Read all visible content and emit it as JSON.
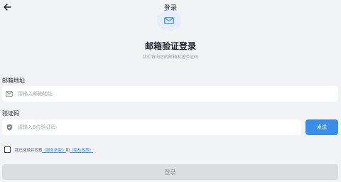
{
  "header": {
    "title": "登录",
    "back_icon": "arrow-left-icon"
  },
  "hero": {
    "icon": "mail-icon",
    "title": "邮箱验证登录",
    "subtitle": "我们将向您的邮箱发送验证码"
  },
  "email": {
    "label": "邮箱地址",
    "icon": "mail-icon",
    "placeholder": "请输入邮箱地址",
    "value": ""
  },
  "code": {
    "label": "验证码",
    "icon": "shield-icon",
    "placeholder": "请输入6位验证码",
    "value": "",
    "send_label": "发送"
  },
  "agreement": {
    "checked": false,
    "prefix": "我已阅读并同意",
    "terms_link": "《服务条款》",
    "and": "和",
    "privacy_link": "《隐私政策》"
  },
  "login_label": "登录",
  "colors": {
    "background": "#f2f3f5",
    "accent": "#3b8ee7",
    "disabled_button": "#dcdddf"
  }
}
